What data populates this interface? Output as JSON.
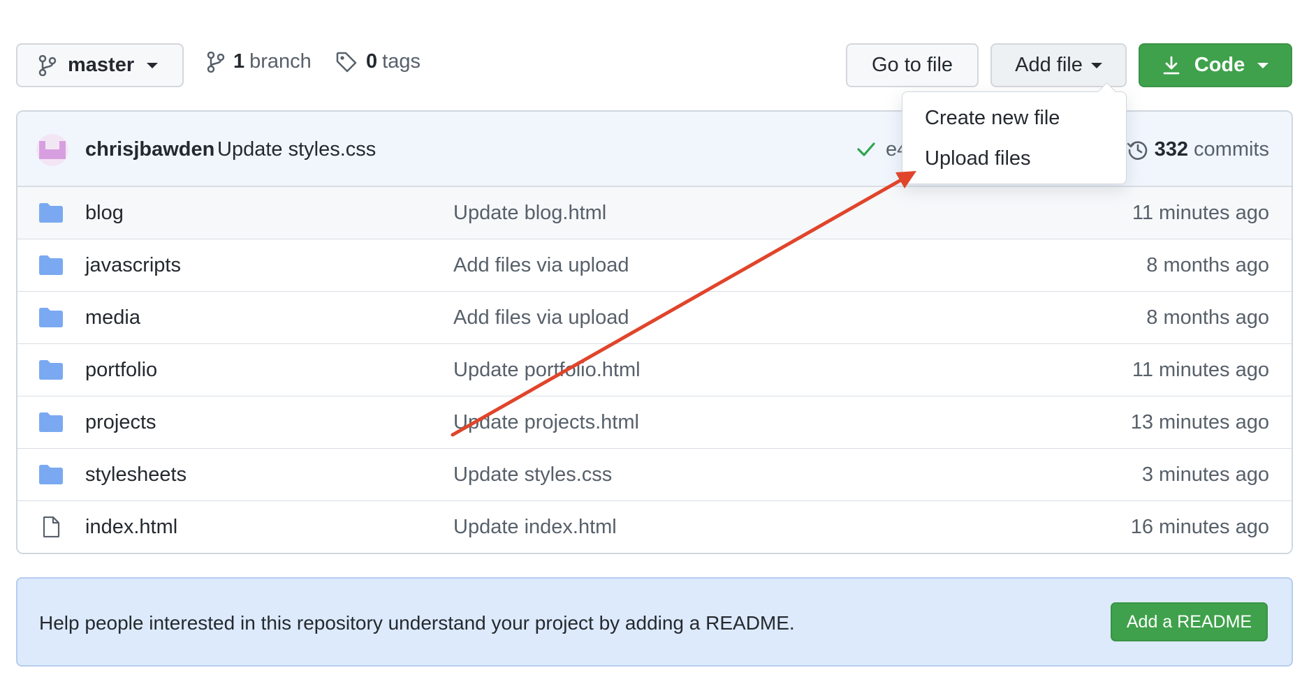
{
  "toolbar": {
    "branch_name": "master",
    "branch_count": "1",
    "branch_word": "branch",
    "tag_count": "0",
    "tag_word": "tags",
    "go_to_file_label": "Go to file",
    "add_file_label": "Add file",
    "code_label": "Code"
  },
  "add_file_menu": {
    "items": [
      {
        "label": "Create new file"
      },
      {
        "label": "Upload files"
      }
    ]
  },
  "commit": {
    "author": "chrisjbawden",
    "message": "Update styles.css",
    "sha_partial": "e4",
    "count": "332",
    "count_word": "commits"
  },
  "files": [
    {
      "name": "blog",
      "type": "folder",
      "message": "Update blog.html",
      "age": "11 minutes ago"
    },
    {
      "name": "javascripts",
      "type": "folder",
      "message": "Add files via upload",
      "age": "8 months ago"
    },
    {
      "name": "media",
      "type": "folder",
      "message": "Add files via upload",
      "age": "8 months ago"
    },
    {
      "name": "portfolio",
      "type": "folder",
      "message": "Update portfolio.html",
      "age": "11 minutes ago"
    },
    {
      "name": "projects",
      "type": "folder",
      "message": "Update projects.html",
      "age": "13 minutes ago"
    },
    {
      "name": "stylesheets",
      "type": "folder",
      "message": "Update styles.css",
      "age": "3 minutes ago"
    },
    {
      "name": "index.html",
      "type": "file",
      "message": "Update index.html",
      "age": "16 minutes ago"
    }
  ],
  "readme": {
    "prompt": "Help people interested in this repository understand your project by adding a README.",
    "button_label": "Add a README"
  },
  "colors": {
    "primary_green": "#3fa14b",
    "folder_blue": "#7aa9f1",
    "annotation_red": "#e0452b",
    "check_green": "#2da44e"
  },
  "icons": {
    "branch": "git-branch-icon",
    "tag": "tag-icon",
    "download": "download-icon",
    "check": "check-icon",
    "history": "history-clock-icon",
    "folder": "folder-icon",
    "file": "file-icon"
  }
}
